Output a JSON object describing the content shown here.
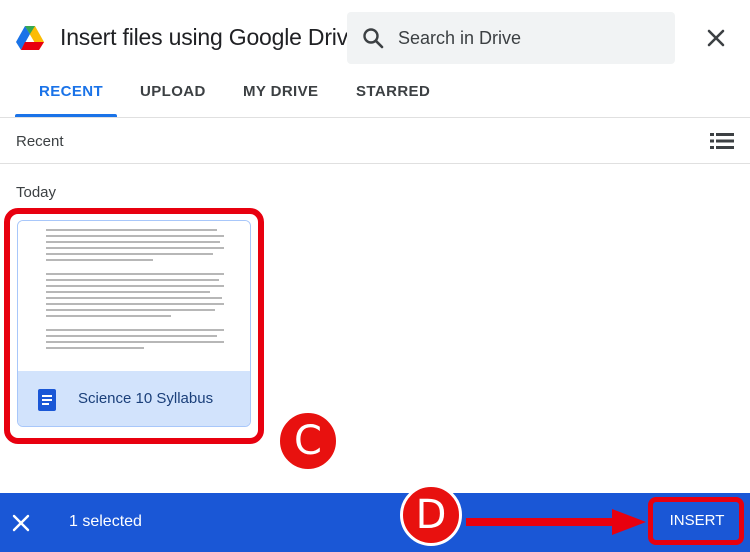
{
  "dialog": {
    "title": "Insert files using Google Drive",
    "search_placeholder": "Search in Drive"
  },
  "tabs": [
    {
      "label": "RECENT",
      "active": true
    },
    {
      "label": "UPLOAD",
      "active": false
    },
    {
      "label": "MY DRIVE",
      "active": false
    },
    {
      "label": "STARRED",
      "active": false
    }
  ],
  "subbar": {
    "label": "Recent"
  },
  "section": {
    "label": "Today"
  },
  "file": {
    "name": "Science 10 Syllabus",
    "selected": true
  },
  "bottom_bar": {
    "selected_text": "1 selected",
    "insert_label": "INSERT"
  },
  "annotations": {
    "c": "C",
    "d": "D"
  },
  "colors": {
    "accent": "#1a73e8",
    "bottom_bar": "#1a57d6",
    "annotation_red": "#e8000f",
    "selected_card": "#d2e3fc"
  },
  "icons": [
    "drive-logo-icon",
    "search-icon",
    "close-icon",
    "list-view-icon",
    "document-icon",
    "deselect-close-icon"
  ]
}
